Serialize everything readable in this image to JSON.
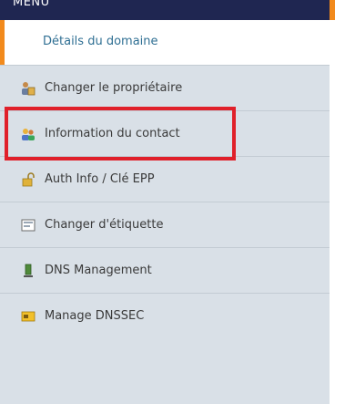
{
  "menu": {
    "header_label": "MENU",
    "active_item": "Détails du domaine",
    "items": [
      {
        "label": "Changer le propriétaire",
        "icon": "owner-change-icon"
      },
      {
        "label": "Information du contact",
        "icon": "contact-info-icon"
      },
      {
        "label": "Auth Info / Clé EPP",
        "icon": "auth-key-icon"
      },
      {
        "label": "Changer d'étiquette",
        "icon": "label-change-icon"
      },
      {
        "label": "DNS Management",
        "icon": "dns-management-icon"
      },
      {
        "label": "Manage DNSSEC",
        "icon": "dnssec-icon"
      }
    ]
  },
  "colors": {
    "header_bg": "#1f2651",
    "accent": "#f28a1c",
    "panel_bg": "#d9e0e7",
    "active_text": "#2f6f93",
    "highlight_border": "#e0202a"
  }
}
